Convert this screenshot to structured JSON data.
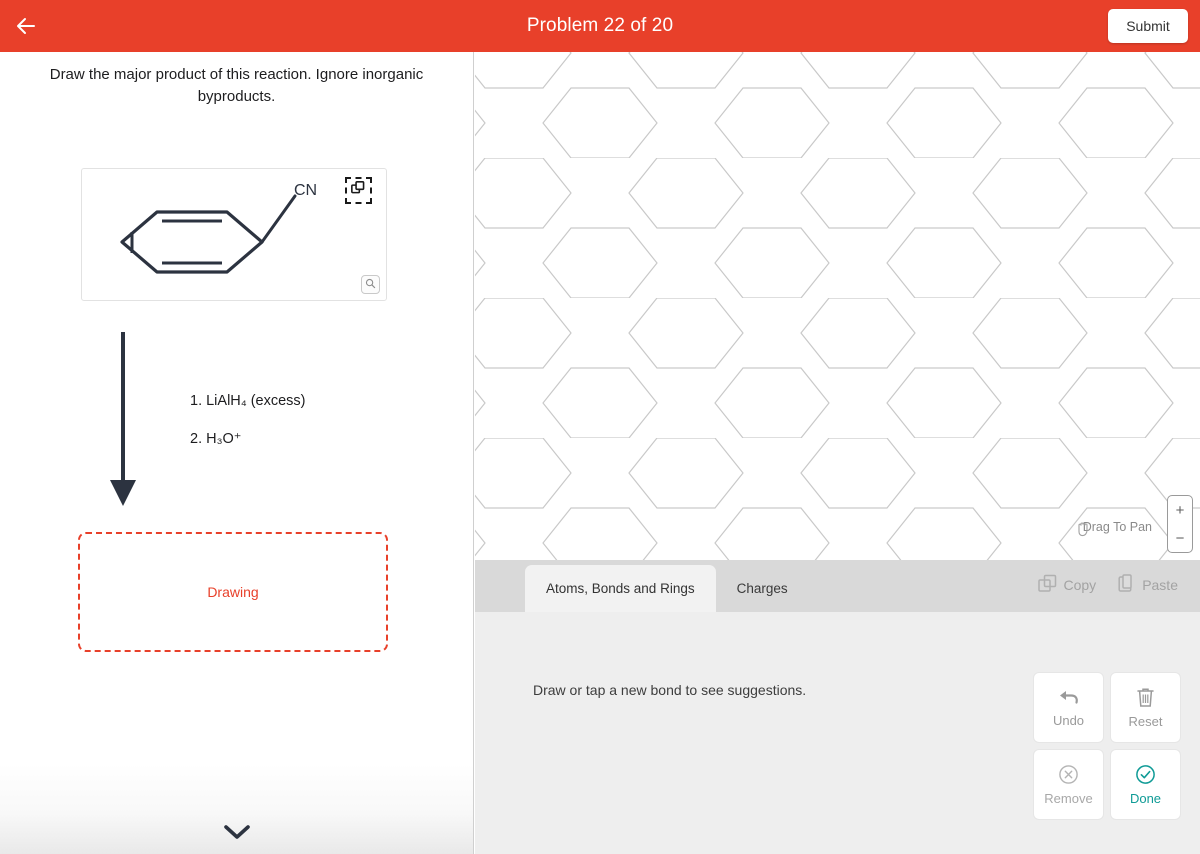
{
  "header": {
    "back_icon": "arrow-left-icon",
    "title": "Problem 22 of 20",
    "submit_label": "Submit",
    "accent_color": "#e8402a"
  },
  "left_panel": {
    "prompt": "Draw the major product of this reaction.  Ignore inorganic byproducts.",
    "reactant": {
      "label": "CN",
      "copy_icon": "copy-icon",
      "magnify_icon": "magnifier-icon"
    },
    "conditions": [
      "1. LiAlH₄ (excess)",
      "2. H₃O⁺"
    ],
    "product_zone": {
      "placeholder": "Drawing"
    },
    "collapse_icon": "chevron-down-icon"
  },
  "sketcher": {
    "grid": {
      "type": "hexagonal",
      "line_color": "#c9c9c9",
      "background": "#ffffff"
    },
    "pan_hint": {
      "icon": "hand-icon",
      "label": "Drag To Pan"
    },
    "zoom": {
      "in_label": "+",
      "out_label": "−"
    },
    "tabs": [
      {
        "label": "Atoms, Bonds and Rings",
        "active": true
      },
      {
        "label": "Charges",
        "active": false
      }
    ],
    "clipboard": [
      {
        "label": "Copy",
        "icon": "copy-icon",
        "enabled": false
      },
      {
        "label": "Paste",
        "icon": "clipboard-icon",
        "enabled": false
      }
    ],
    "hint": "Draw or tap a new bond to see suggestions.",
    "tools": [
      {
        "label": "Undo",
        "icon": "undo-arrow-icon",
        "state": "disabled"
      },
      {
        "label": "Reset",
        "icon": "trash-icon",
        "state": "disabled"
      },
      {
        "label": "Remove",
        "icon": "circle-x-icon",
        "state": "disabled"
      },
      {
        "label": "Done",
        "icon": "circle-check-icon",
        "state": "active",
        "color": "#0f9b96"
      }
    ]
  }
}
